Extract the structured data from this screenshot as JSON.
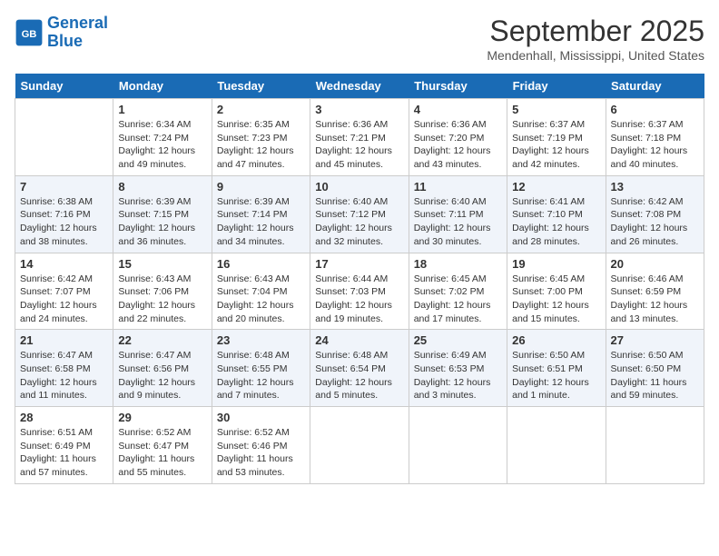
{
  "header": {
    "logo_line1": "General",
    "logo_line2": "Blue",
    "month": "September 2025",
    "location": "Mendenhall, Mississippi, United States"
  },
  "weekdays": [
    "Sunday",
    "Monday",
    "Tuesday",
    "Wednesday",
    "Thursday",
    "Friday",
    "Saturday"
  ],
  "weeks": [
    [
      {
        "day": "",
        "info": ""
      },
      {
        "day": "1",
        "info": "Sunrise: 6:34 AM\nSunset: 7:24 PM\nDaylight: 12 hours\nand 49 minutes."
      },
      {
        "day": "2",
        "info": "Sunrise: 6:35 AM\nSunset: 7:23 PM\nDaylight: 12 hours\nand 47 minutes."
      },
      {
        "day": "3",
        "info": "Sunrise: 6:36 AM\nSunset: 7:21 PM\nDaylight: 12 hours\nand 45 minutes."
      },
      {
        "day": "4",
        "info": "Sunrise: 6:36 AM\nSunset: 7:20 PM\nDaylight: 12 hours\nand 43 minutes."
      },
      {
        "day": "5",
        "info": "Sunrise: 6:37 AM\nSunset: 7:19 PM\nDaylight: 12 hours\nand 42 minutes."
      },
      {
        "day": "6",
        "info": "Sunrise: 6:37 AM\nSunset: 7:18 PM\nDaylight: 12 hours\nand 40 minutes."
      }
    ],
    [
      {
        "day": "7",
        "info": "Sunrise: 6:38 AM\nSunset: 7:16 PM\nDaylight: 12 hours\nand 38 minutes."
      },
      {
        "day": "8",
        "info": "Sunrise: 6:39 AM\nSunset: 7:15 PM\nDaylight: 12 hours\nand 36 minutes."
      },
      {
        "day": "9",
        "info": "Sunrise: 6:39 AM\nSunset: 7:14 PM\nDaylight: 12 hours\nand 34 minutes."
      },
      {
        "day": "10",
        "info": "Sunrise: 6:40 AM\nSunset: 7:12 PM\nDaylight: 12 hours\nand 32 minutes."
      },
      {
        "day": "11",
        "info": "Sunrise: 6:40 AM\nSunset: 7:11 PM\nDaylight: 12 hours\nand 30 minutes."
      },
      {
        "day": "12",
        "info": "Sunrise: 6:41 AM\nSunset: 7:10 PM\nDaylight: 12 hours\nand 28 minutes."
      },
      {
        "day": "13",
        "info": "Sunrise: 6:42 AM\nSunset: 7:08 PM\nDaylight: 12 hours\nand 26 minutes."
      }
    ],
    [
      {
        "day": "14",
        "info": "Sunrise: 6:42 AM\nSunset: 7:07 PM\nDaylight: 12 hours\nand 24 minutes."
      },
      {
        "day": "15",
        "info": "Sunrise: 6:43 AM\nSunset: 7:06 PM\nDaylight: 12 hours\nand 22 minutes."
      },
      {
        "day": "16",
        "info": "Sunrise: 6:43 AM\nSunset: 7:04 PM\nDaylight: 12 hours\nand 20 minutes."
      },
      {
        "day": "17",
        "info": "Sunrise: 6:44 AM\nSunset: 7:03 PM\nDaylight: 12 hours\nand 19 minutes."
      },
      {
        "day": "18",
        "info": "Sunrise: 6:45 AM\nSunset: 7:02 PM\nDaylight: 12 hours\nand 17 minutes."
      },
      {
        "day": "19",
        "info": "Sunrise: 6:45 AM\nSunset: 7:00 PM\nDaylight: 12 hours\nand 15 minutes."
      },
      {
        "day": "20",
        "info": "Sunrise: 6:46 AM\nSunset: 6:59 PM\nDaylight: 12 hours\nand 13 minutes."
      }
    ],
    [
      {
        "day": "21",
        "info": "Sunrise: 6:47 AM\nSunset: 6:58 PM\nDaylight: 12 hours\nand 11 minutes."
      },
      {
        "day": "22",
        "info": "Sunrise: 6:47 AM\nSunset: 6:56 PM\nDaylight: 12 hours\nand 9 minutes."
      },
      {
        "day": "23",
        "info": "Sunrise: 6:48 AM\nSunset: 6:55 PM\nDaylight: 12 hours\nand 7 minutes."
      },
      {
        "day": "24",
        "info": "Sunrise: 6:48 AM\nSunset: 6:54 PM\nDaylight: 12 hours\nand 5 minutes."
      },
      {
        "day": "25",
        "info": "Sunrise: 6:49 AM\nSunset: 6:53 PM\nDaylight: 12 hours\nand 3 minutes."
      },
      {
        "day": "26",
        "info": "Sunrise: 6:50 AM\nSunset: 6:51 PM\nDaylight: 12 hours\nand 1 minute."
      },
      {
        "day": "27",
        "info": "Sunrise: 6:50 AM\nSunset: 6:50 PM\nDaylight: 11 hours\nand 59 minutes."
      }
    ],
    [
      {
        "day": "28",
        "info": "Sunrise: 6:51 AM\nSunset: 6:49 PM\nDaylight: 11 hours\nand 57 minutes."
      },
      {
        "day": "29",
        "info": "Sunrise: 6:52 AM\nSunset: 6:47 PM\nDaylight: 11 hours\nand 55 minutes."
      },
      {
        "day": "30",
        "info": "Sunrise: 6:52 AM\nSunset: 6:46 PM\nDaylight: 11 hours\nand 53 minutes."
      },
      {
        "day": "",
        "info": ""
      },
      {
        "day": "",
        "info": ""
      },
      {
        "day": "",
        "info": ""
      },
      {
        "day": "",
        "info": ""
      }
    ]
  ]
}
